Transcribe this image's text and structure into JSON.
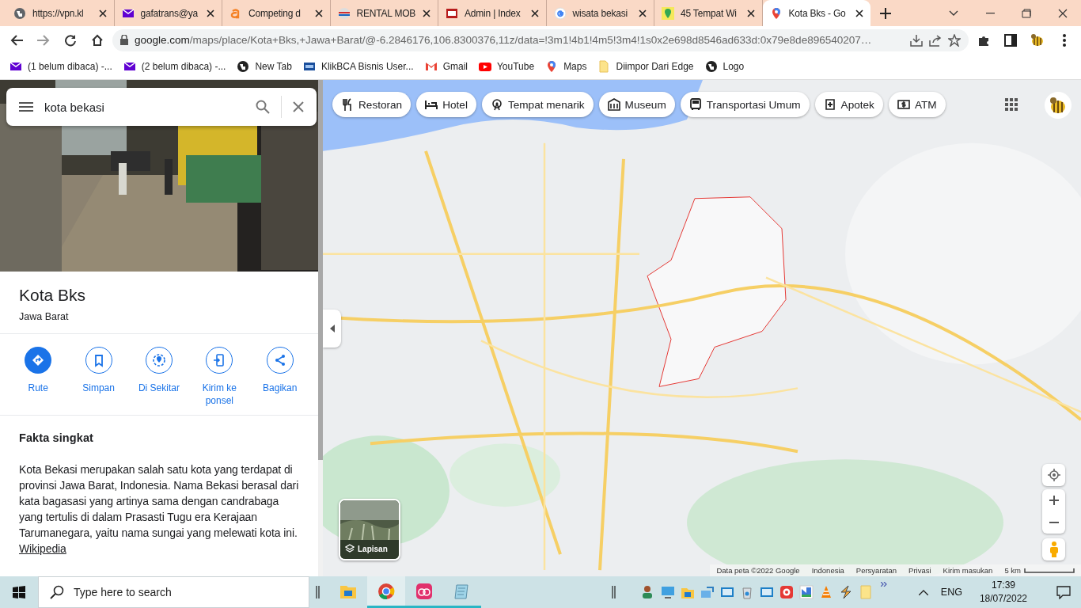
{
  "browser": {
    "tabs": [
      {
        "title": "https://vpn.kl",
        "selected": false
      },
      {
        "title": "gafatrans@ya",
        "selected": false
      },
      {
        "title": "Competing d",
        "selected": false
      },
      {
        "title": "RENTAL MOB",
        "selected": false
      },
      {
        "title": "Admin | Index",
        "selected": false
      },
      {
        "title": "wisata bekasi",
        "selected": false
      },
      {
        "title": "45 Tempat Wi",
        "selected": false
      },
      {
        "title": "Kota Bks - Go",
        "selected": true
      }
    ],
    "address": {
      "host": "google.com",
      "path": "/maps/place/Kota+Bks,+Jawa+Barat/@-6.2846176,106.8300376,11z/data=!3m1!4b1!4m5!3m4!1s0x2e698d8546ad633d:0x79e8de896540207…"
    },
    "bookmarks": [
      "(1 belum dibaca) -...",
      "(2 belum dibaca) -...",
      "New Tab",
      "KlikBCA Bisnis User...",
      "Gmail",
      "YouTube",
      "Maps",
      "Diimpor Dari Edge",
      "Logo"
    ]
  },
  "search": {
    "value": "kota bekasi"
  },
  "place": {
    "title": "Kota Bks",
    "subtitle": "Jawa Barat",
    "actions": [
      {
        "label": "Rute",
        "kind": "primary"
      },
      {
        "label": "Simpan",
        "kind": "outline"
      },
      {
        "label": "Di Sekitar",
        "kind": "outline"
      },
      {
        "label": "Kirim ke ponsel",
        "kind": "outline"
      },
      {
        "label": "Bagikan",
        "kind": "outline"
      }
    ],
    "facts_heading": "Fakta singkat",
    "facts_text": "Kota Bekasi merupakan salah satu kota yang terdapat di provinsi Jawa Barat, Indonesia. Nama Bekasi berasal dari kata bagasasi yang artinya sama dengan candrabaga yang tertulis di dalam Prasasti Tugu era Kerajaan Tarumanegara, yaitu nama sungai yang melewati kota ini.",
    "facts_link": "Wikipedia"
  },
  "map": {
    "categories": [
      "Restoran",
      "Hotel",
      "Tempat menarik",
      "Museum",
      "Transportasi Umum",
      "Apotek",
      "ATM"
    ],
    "layers_label": "Lapisan",
    "footer": [
      "Data peta ©2022 Google",
      "Indonesia",
      "Persyaratan",
      "Privasi",
      "Kirim masukan"
    ],
    "scale": "5 km"
  },
  "taskbar": {
    "search_placeholder": "Type here to search",
    "apps": [
      {
        "running": false,
        "selected": false
      },
      {
        "running": true,
        "selected": true
      },
      {
        "running": true,
        "selected": false
      },
      {
        "running": true,
        "selected": false
      }
    ],
    "language": "ENG",
    "time": "17:39",
    "date": "18/07/2022"
  }
}
